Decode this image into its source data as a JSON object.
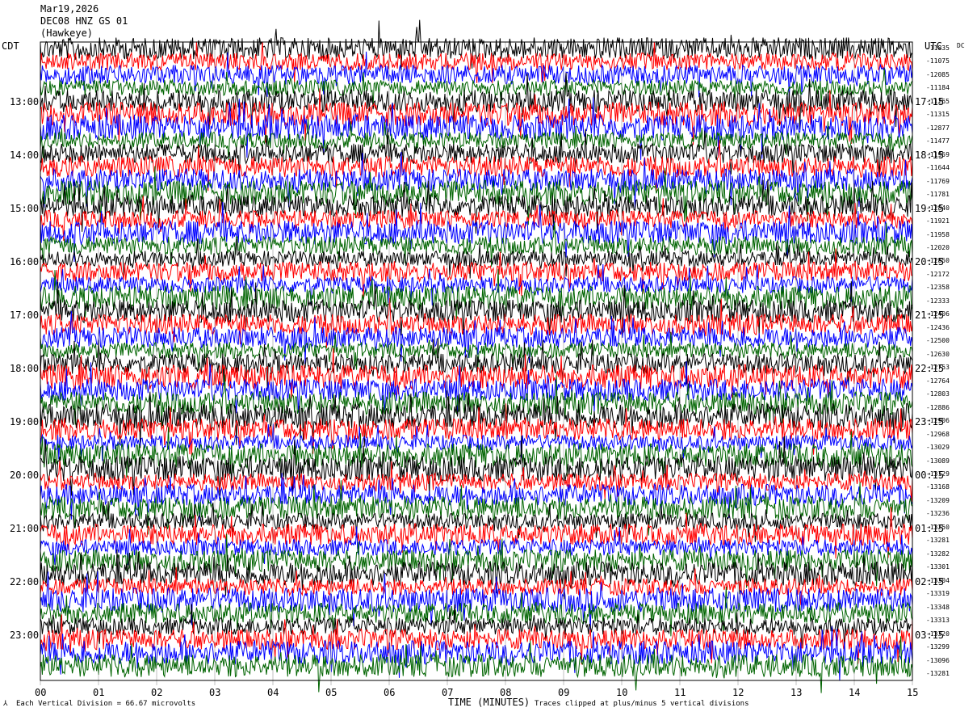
{
  "header": {
    "date": "Mar19,2026",
    "station": "DEC08 HNZ GS 01",
    "extra": "(Hawkeye)"
  },
  "left_axis_title": "CDT",
  "right_axis_title": "UTC",
  "right_value_header": "DC",
  "footer": {
    "scale": "Each Vertical Division =   66.67 microvolts",
    "xlabel": "TIME (MINUTES)",
    "clip": "Traces clipped at plus/minus 5 vertical divisions"
  },
  "colors": [
    "#000000",
    "#ff0000",
    "#0000ff",
    "#006400"
  ],
  "chart_data": {
    "type": "line",
    "title": "Mar19,2026 DEC08 HNZ GS 01",
    "xlabel": "TIME (MINUTES)",
    "xlim": [
      0,
      15
    ],
    "x_ticks": [
      "00",
      "01",
      "02",
      "03",
      "04",
      "05",
      "06",
      "07",
      "08",
      "09",
      "10",
      "11",
      "12",
      "13",
      "14",
      "15"
    ],
    "left_labels": [
      "13:00",
      "14:00",
      "15:00",
      "16:00",
      "17:00",
      "18:00",
      "19:00",
      "20:00",
      "21:00",
      "22:00",
      "23:00"
    ],
    "right_labels": [
      "17:15",
      "18:15",
      "19:15",
      "20:15",
      "21:15",
      "22:15",
      "23:15",
      "00:15",
      "01:15",
      "02:15",
      "03:15"
    ],
    "row_offsets": [
      "-11835",
      "-11075",
      "-12085",
      "-11184",
      "-11265",
      "-11315",
      "-12877",
      "-11477",
      "-11959",
      "-11644",
      "-11769",
      "-11781",
      "-12840",
      "-11921",
      "-11958",
      "-12020",
      "-12850",
      "-12172",
      "-12358",
      "-12333",
      "-12406",
      "-12436",
      "-12500",
      "-12630",
      "-12753",
      "-12764",
      "-12803",
      "-12886",
      "-12906",
      "-12968",
      "-13029",
      "-13089",
      "-13129",
      "-13168",
      "-13209",
      "-13236",
      "-13250",
      "-13281",
      "-13282",
      "-13301",
      "-13304",
      "-13319",
      "-13348",
      "-13313",
      "-13320",
      "-13299",
      "-13096",
      "-13281"
    ],
    "trace_colors": [
      "black",
      "red",
      "blue",
      "green"
    ],
    "rows_per_hour": 4,
    "scale_microvolts_per_division": 66.67,
    "clip_divisions": 5
  }
}
